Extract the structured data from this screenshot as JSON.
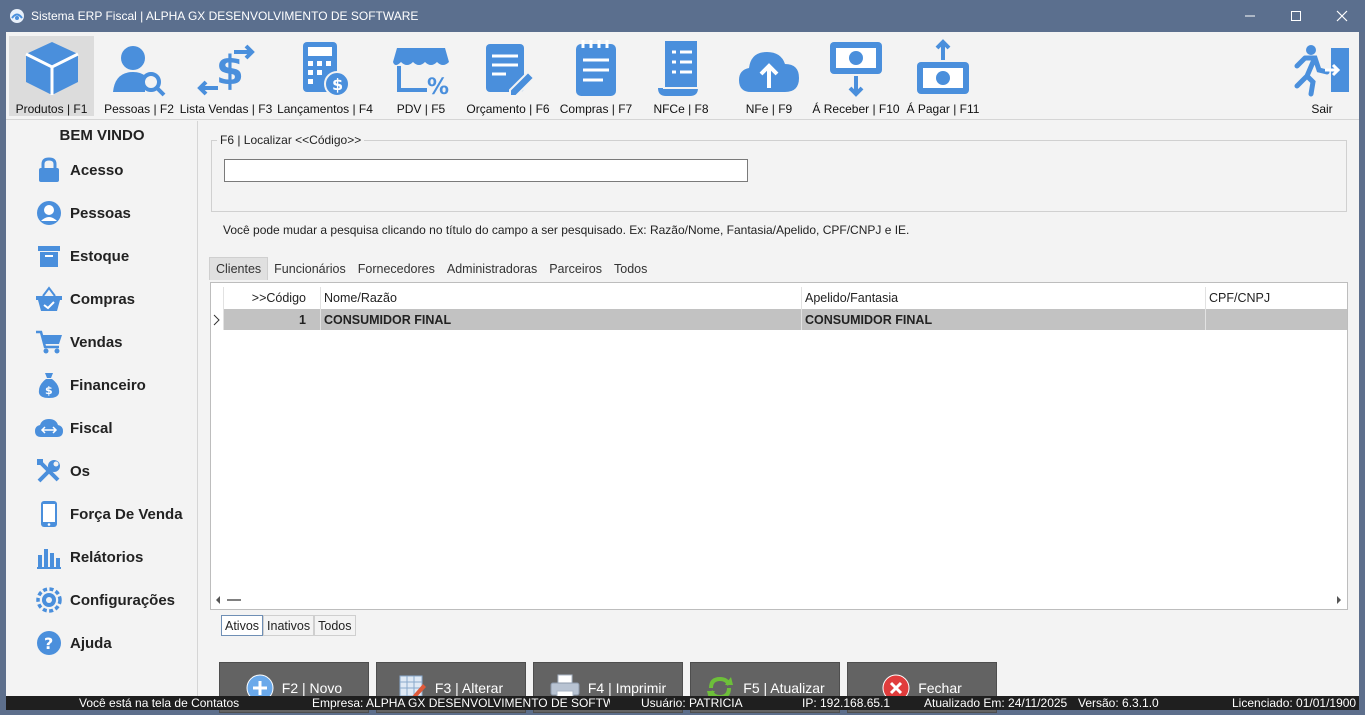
{
  "window": {
    "title": "Sistema ERP Fiscal | ALPHA GX DESENVOLVIMENTO DE SOFTWARE"
  },
  "toolbar": {
    "items": [
      {
        "label": "Produtos | F1",
        "icon": "box-icon"
      },
      {
        "label": "Pessoas | F2",
        "icon": "person-search-icon"
      },
      {
        "label": "Lista Vendas | F3",
        "icon": "dollar-exchange-icon"
      },
      {
        "label": "Lançamentos | F4",
        "icon": "calculator-icon"
      },
      {
        "label": "PDV | F5",
        "icon": "store-percent-icon"
      },
      {
        "label": "Orçamento | F6",
        "icon": "document-edit-icon"
      },
      {
        "label": "Compras | F7",
        "icon": "clipboard-list-icon"
      },
      {
        "label": "NFCe | F8",
        "icon": "receipt-icon"
      },
      {
        "label": "NFe | F9",
        "icon": "cloud-upload-icon"
      },
      {
        "label": "Á Receber | F10",
        "icon": "money-in-icon"
      },
      {
        "label": "Á Pagar | F11",
        "icon": "money-out-icon"
      },
      {
        "label": "Sair",
        "icon": "exit-icon"
      }
    ]
  },
  "sidebar": {
    "welcome": "BEM VINDO",
    "items": [
      {
        "label": "Acesso",
        "icon": "lock-icon"
      },
      {
        "label": "Pessoas",
        "icon": "user-icon"
      },
      {
        "label": "Estoque",
        "icon": "archive-icon"
      },
      {
        "label": "Compras",
        "icon": "basket-icon"
      },
      {
        "label": "Vendas",
        "icon": "cart-icon"
      },
      {
        "label": "Financeiro",
        "icon": "money-bag-icon"
      },
      {
        "label": "Fiscal",
        "icon": "cloud-sync-icon"
      },
      {
        "label": "Os",
        "icon": "tools-icon"
      },
      {
        "label": "Força De Venda",
        "icon": "mobile-icon"
      },
      {
        "label": "Relátorios",
        "icon": "bar-chart-icon"
      },
      {
        "label": "Configurações",
        "icon": "gear-icon"
      },
      {
        "label": "Ajuda",
        "icon": "help-icon"
      }
    ]
  },
  "search": {
    "legend": "F6 | Localizar <<Código>>",
    "value": "",
    "hint": "Você pode mudar a pesquisa clicando no título do campo a ser pesquisado. Ex: Razão/Nome, Fantasia/Apelido, CPF/CNPJ e IE."
  },
  "tabs": [
    "Clientes",
    "Funcionários",
    "Fornecedores",
    "Administradoras",
    "Parceiros",
    "Todos"
  ],
  "grid": {
    "columns": [
      ">>Código",
      "Nome/Razão",
      "Apelido/Fantasia",
      "CPF/CNPJ"
    ],
    "rows": [
      {
        "codigo": "1",
        "nome": "CONSUMIDOR FINAL",
        "apelido": "CONSUMIDOR FINAL",
        "cpf": ""
      }
    ]
  },
  "filters": [
    "Ativos",
    "Inativos",
    "Todos"
  ],
  "actions": [
    {
      "label": "F2 | Novo",
      "icon": "plus-circle-icon"
    },
    {
      "label": "F3 | Alterar",
      "icon": "edit-table-icon"
    },
    {
      "label": "F4 | Imprimir",
      "icon": "printer-icon"
    },
    {
      "label": "F5 | Atualizar",
      "icon": "refresh-icon"
    },
    {
      "label": "Fechar",
      "icon": "close-circle-icon"
    }
  ],
  "status": {
    "screen": "Você está na tela de Contatos",
    "empresa": "Empresa: ALPHA GX DESENVOLVIMENTO DE SOFTWAF",
    "usuario": "Usuário: PATRICIA",
    "ip": "IP: 192.168.65.1",
    "atualizado": "Atualizado Em: 24/11/2025",
    "versao": "Versão: 6.3.1.0",
    "licenciado": "Licenciado: 01/01/1900"
  },
  "colors": {
    "accent": "#4a8fdc",
    "titlebar": "#5b6f8e",
    "button": "#636363",
    "statusbar": "#1f1f1f"
  }
}
